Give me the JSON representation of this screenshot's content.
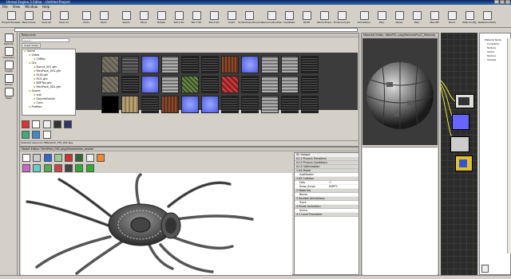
{
  "window": {
    "title": "Unreal Engine 3 Editor - Untitled Project",
    "controls": [
      "_",
      "□",
      "×"
    ]
  },
  "menu": [
    "File",
    "View",
    "Window",
    "Help"
  ],
  "toolbar": [
    {
      "label": "Project Browser",
      "icon": "folder-icon"
    },
    {
      "label": "New Scene",
      "icon": "new-doc-icon"
    },
    {
      "label": "Save All",
      "icon": "save-icon"
    },
    {
      "label": "Save As",
      "icon": "save-as-icon"
    },
    {
      "label": "Undo",
      "icon": "undo-icon"
    },
    {
      "label": "Redo",
      "icon": "redo-icon"
    },
    {
      "label": "Select",
      "icon": "select-icon"
    },
    {
      "label": "Move",
      "icon": "move-icon"
    },
    {
      "label": "Rotate",
      "icon": "rotate-icon"
    },
    {
      "label": "Rot X 90",
      "icon": "rotx-icon"
    },
    {
      "label": "Rot Y 90",
      "icon": "roty-icon"
    },
    {
      "label": "Rot Z 90",
      "icon": "rotz-icon"
    },
    {
      "label": "Scale",
      "icon": "scale-icon"
    },
    {
      "label": "Scale Proportional",
      "icon": "scale-prop-icon"
    },
    {
      "label": "Resource Browser",
      "icon": "resource-browser-icon"
    },
    {
      "label": "LoadData",
      "icon": "load-data-icon"
    },
    {
      "label": "WoTE",
      "icon": "wote-icon"
    },
    {
      "label": "World Props",
      "icon": "world-props-icon"
    },
    {
      "label": "Product Props",
      "icon": "product-props-icon"
    },
    {
      "label": "Simulation",
      "icon": "simulation-icon"
    },
    {
      "label": "Play",
      "icon": "play-icon"
    },
    {
      "label": "Pause",
      "icon": "pause-icon"
    },
    {
      "label": "Play",
      "icon": "play2-icon"
    },
    {
      "label": "Max Eff",
      "icon": "max-eff-icon"
    },
    {
      "label": "Build",
      "icon": "build-icon"
    },
    {
      "label": "Path Config",
      "icon": "path-config-icon"
    },
    {
      "label": "Realtime Mode",
      "icon": "realtime-icon"
    }
  ],
  "left_tools": [
    {
      "label": "Explorer",
      "icon": "explorer-icon"
    },
    {
      "label": "Geometry",
      "icon": "geometry-icon"
    },
    {
      "label": "Create",
      "icon": "create-icon"
    },
    {
      "label": "Terrain",
      "icon": "terrain-icon"
    },
    {
      "label": "Mesh",
      "icon": "mesh-icon"
    }
  ],
  "resources": {
    "title": "Resources",
    "search_placeholder": "Search",
    "tab": "Asset Views",
    "tree": [
      {
        "depth": 0,
        "label": "Game"
      },
      {
        "depth": 1,
        "label": "Video"
      },
      {
        "depth": 2,
        "label": "1080p"
      },
      {
        "depth": 1,
        "label": "Gfx"
      },
      {
        "depth": 2,
        "label": "Donut_001.gfx"
      },
      {
        "depth": 2,
        "label": "MenPack_001.gfx"
      },
      {
        "depth": 2,
        "label": "HUD.gfx"
      },
      {
        "depth": 2,
        "label": "RO1.gfx"
      },
      {
        "depth": 2,
        "label": "BSPTex.gfx"
      },
      {
        "depth": 2,
        "label": "MenPack_002.gfx"
      },
      {
        "depth": 1,
        "label": "Sound"
      },
      {
        "depth": 2,
        "label": "sub"
      },
      {
        "depth": 2,
        "label": "SoundsFolder"
      },
      {
        "depth": 2,
        "label": "Core"
      },
      {
        "depth": 1,
        "label": "Profiles"
      }
    ],
    "thumbs": [
      "stone",
      "grid",
      "blue",
      "metal",
      "dark",
      "dark",
      "rust",
      "blue",
      "metal",
      "metal",
      "dark",
      "stone",
      "dark",
      "blue",
      "metal",
      "green",
      "dark",
      "red",
      "dark",
      "metal",
      "metal",
      "dark",
      "black",
      "tan",
      "dark",
      "rust",
      "blue",
      "blue",
      "dark",
      "dark",
      "metal",
      "dark",
      "dark"
    ],
    "status": "Selected resource: PBSLab/UI_TEX_001.pkg"
  },
  "material_editor": {
    "title": "Material Editor: WebPOL.pkg/MaterialPro/1_Material"
  },
  "model_editor": {
    "title": "Model Editor: PerkPred_001.pkg/Geometries_model"
  },
  "properties": {
    "header": "ID: Unique",
    "rows": [
      {
        "type": "cat",
        "label": "01.1 Physics Transform"
      },
      {
        "type": "cat",
        "label": "01.2 Physics Conditions"
      },
      {
        "type": "cat",
        "label": "01.3 Optimization"
      },
      {
        "type": "cat",
        "label": "1.04 Model"
      },
      {
        "type": "kv",
        "key": "SubModels",
        "value": ""
      },
      {
        "type": "cat",
        "label": "1.05 Collision"
      },
      {
        "type": "kv",
        "key": "Falls",
        "value": "☐"
      },
      {
        "type": "kv",
        "key": "Draw_Script",
        "value": "EMPTY"
      },
      {
        "type": "cat",
        "label": "2 Materials"
      },
      {
        "type": "kv",
        "key": "Bones",
        "value": ""
      },
      {
        "type": "cat",
        "label": "3 Sockets Animations"
      },
      {
        "type": "kv",
        "key": "Track",
        "value": ""
      },
      {
        "type": "cat",
        "label": "4 Sheet Animation"
      },
      {
        "type": "kv",
        "key": "Anims",
        "value": ""
      },
      {
        "type": "cat",
        "label": "4.1 Local Transform"
      }
    ]
  },
  "scene_tree": {
    "items": [
      "Material Node",
      "Constants",
      "Texture",
      "Vector",
      "Texture",
      "Sample"
    ]
  }
}
